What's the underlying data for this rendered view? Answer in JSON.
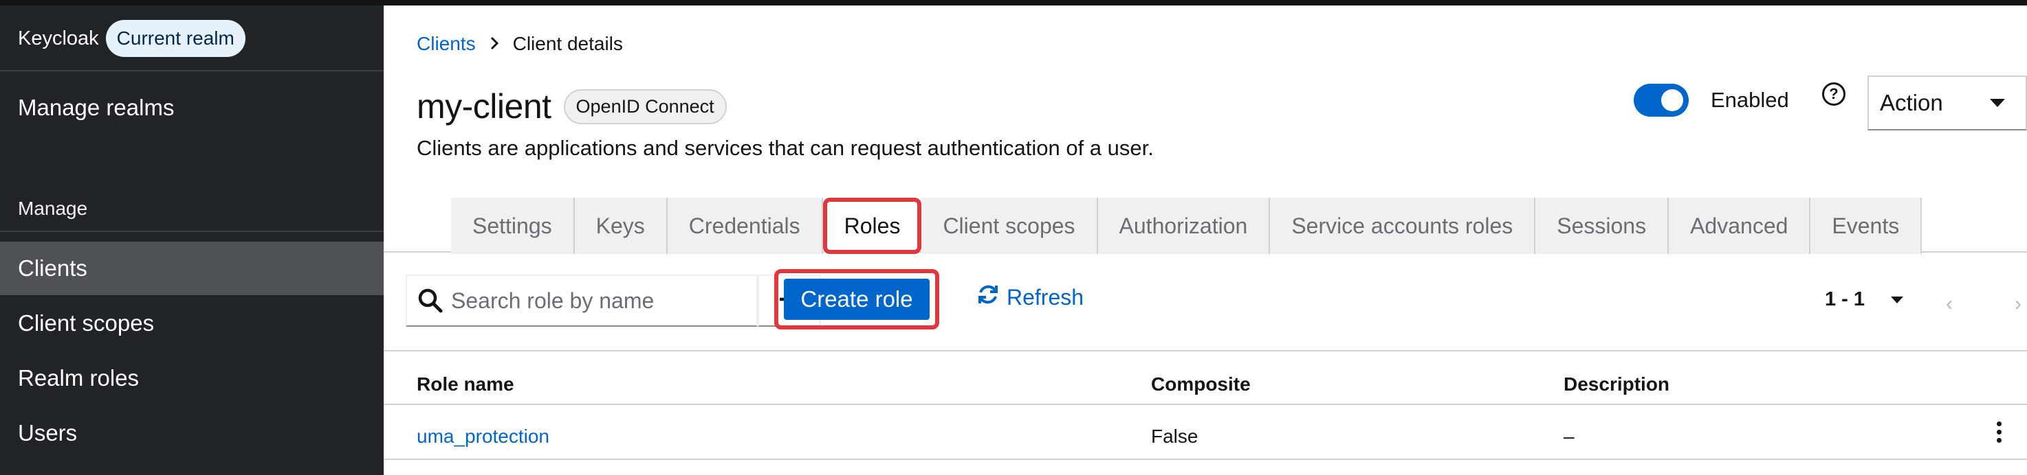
{
  "sidebar": {
    "brand": "Keycloak",
    "realm_badge": "Current realm",
    "manage_realms": "Manage realms",
    "section_label": "Manage",
    "items": [
      {
        "label": "Clients",
        "active": true
      },
      {
        "label": "Client scopes",
        "active": false
      },
      {
        "label": "Realm roles",
        "active": false
      },
      {
        "label": "Users",
        "active": false
      }
    ]
  },
  "breadcrumb": {
    "parent": "Clients",
    "current": "Client details"
  },
  "header": {
    "title": "my-client",
    "protocol_badge": "OpenID Connect",
    "subtitle": "Clients are applications and services that can request authentication of a user.",
    "enabled_label": "Enabled",
    "enabled": true,
    "help_glyph": "?",
    "action_label": "Action"
  },
  "tabs": [
    {
      "label": "Settings"
    },
    {
      "label": "Keys"
    },
    {
      "label": "Credentials"
    },
    {
      "label": "Roles",
      "active": true
    },
    {
      "label": "Client scopes"
    },
    {
      "label": "Authorization"
    },
    {
      "label": "Service accounts roles"
    },
    {
      "label": "Sessions"
    },
    {
      "label": "Advanced"
    },
    {
      "label": "Events"
    }
  ],
  "toolbar": {
    "search_placeholder": "Search role by name",
    "search_value": "",
    "create_label": "Create role",
    "refresh_label": "Refresh",
    "pagination_label": "1 - 1"
  },
  "table": {
    "columns": [
      "Role name",
      "Composite",
      "Description"
    ],
    "rows": [
      {
        "role_name": "uma_protection",
        "composite": "False",
        "description": "–"
      }
    ]
  },
  "colors": {
    "sidebar_bg": "#212427",
    "sidebar_active": "#4f5255",
    "primary": "#0066cc",
    "highlight": "#e0383e"
  }
}
